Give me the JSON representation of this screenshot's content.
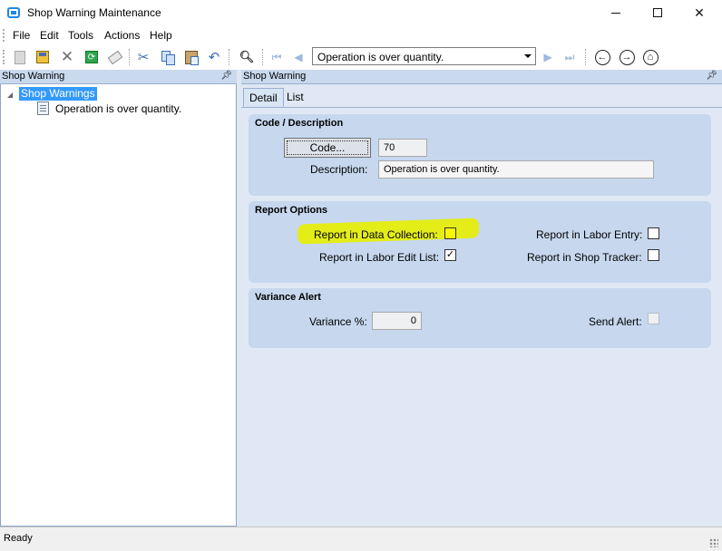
{
  "window": {
    "title": "Shop Warning Maintenance",
    "controls": {
      "minimize": "—",
      "maximize": "☐",
      "close": "✕"
    }
  },
  "menu": [
    "File",
    "Edit",
    "Tools",
    "Actions",
    "Help"
  ],
  "toolbar": {
    "icons": [
      "new-icon",
      "save-icon",
      "delete-icon",
      "refresh-icon",
      "clear-icon",
      "cut-icon",
      "copy-icon",
      "paste-icon",
      "undo-icon",
      "find-icon",
      "first-record-icon",
      "previous-record-icon",
      "next-record-icon",
      "last-record-icon",
      "back-icon",
      "forward-icon",
      "home-icon"
    ],
    "record_selector": {
      "value": "Operation is over quantity."
    }
  },
  "left_panel": {
    "header": "Shop Warning",
    "tree": {
      "root": "Shop Warnings",
      "children": [
        "Operation is over quantity."
      ]
    }
  },
  "right_panel": {
    "header": "Shop Warning",
    "tabs": [
      {
        "label": "Detail",
        "active": true
      },
      {
        "label": "List",
        "active": false
      }
    ]
  },
  "code_description": {
    "title": "Code / Description",
    "code_button": "Code...",
    "code_value": "70",
    "description_label": "Description:",
    "description_value": "Operation is over quantity."
  },
  "report_options": {
    "title": "Report Options",
    "data_collection": {
      "label": "Report in Data Collection:",
      "checked": false,
      "highlighted": true
    },
    "labor_edit_list": {
      "label": "Report in Labor Edit List:",
      "checked": true,
      "mark": "✓"
    },
    "labor_entry": {
      "label": "Report in Labor Entry:",
      "checked": false
    },
    "shop_tracker": {
      "label": "Report in Shop Tracker:",
      "checked": false
    }
  },
  "variance_alert": {
    "title": "Variance Alert",
    "variance_label": "Variance %:",
    "variance_value": "0",
    "send_alert_label": "Send Alert:",
    "send_alert_checked": false
  },
  "status": {
    "text": "Ready"
  },
  "colors": {
    "highlight": "#e7f000",
    "tree_selection": "#3399ff",
    "group_bg": "#c6d7ee",
    "content_bg": "#dfe8f4"
  }
}
